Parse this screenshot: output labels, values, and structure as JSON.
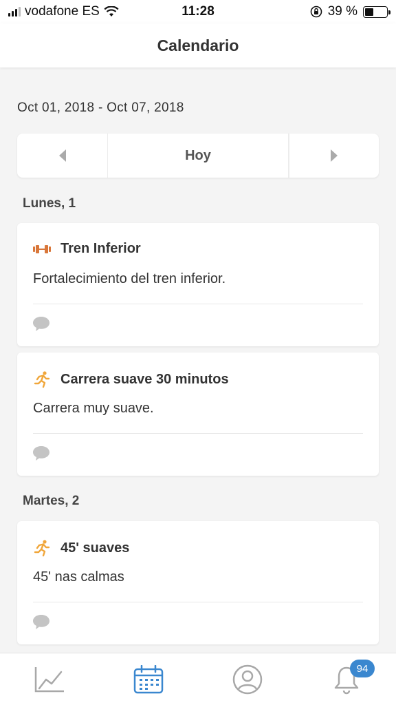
{
  "status_bar": {
    "carrier": "vodafone ES",
    "time": "11:28",
    "battery": "39 %",
    "battery_level": 0.39
  },
  "nav": {
    "title": "Calendario"
  },
  "week": {
    "range": "Oct 01, 2018 - Oct 07, 2018",
    "today_label": "Hoy"
  },
  "days": [
    {
      "label": "Lunes, 1",
      "items": [
        {
          "icon": "dumbbell-icon",
          "title": "Tren Inferior",
          "description": "Fortalecimiento del tren inferior."
        },
        {
          "icon": "runner-icon",
          "title": "Carrera suave 30 minutos",
          "description": "Carrera muy suave."
        }
      ]
    },
    {
      "label": "Martes, 2",
      "items": [
        {
          "icon": "runner-icon",
          "title": "45' suaves",
          "description": "45' nas calmas"
        }
      ]
    }
  ],
  "tab_bar": {
    "notifications_badge": "94",
    "tabs": [
      "stats-icon",
      "calendar-icon",
      "profile-icon",
      "bell-icon"
    ],
    "active_tab": "calendar-icon"
  },
  "colors": {
    "accent": "#3a87cf",
    "dumbbell": "#d9773a",
    "runner": "#f0a63a",
    "inactive_icon": "#a8a8a8"
  }
}
